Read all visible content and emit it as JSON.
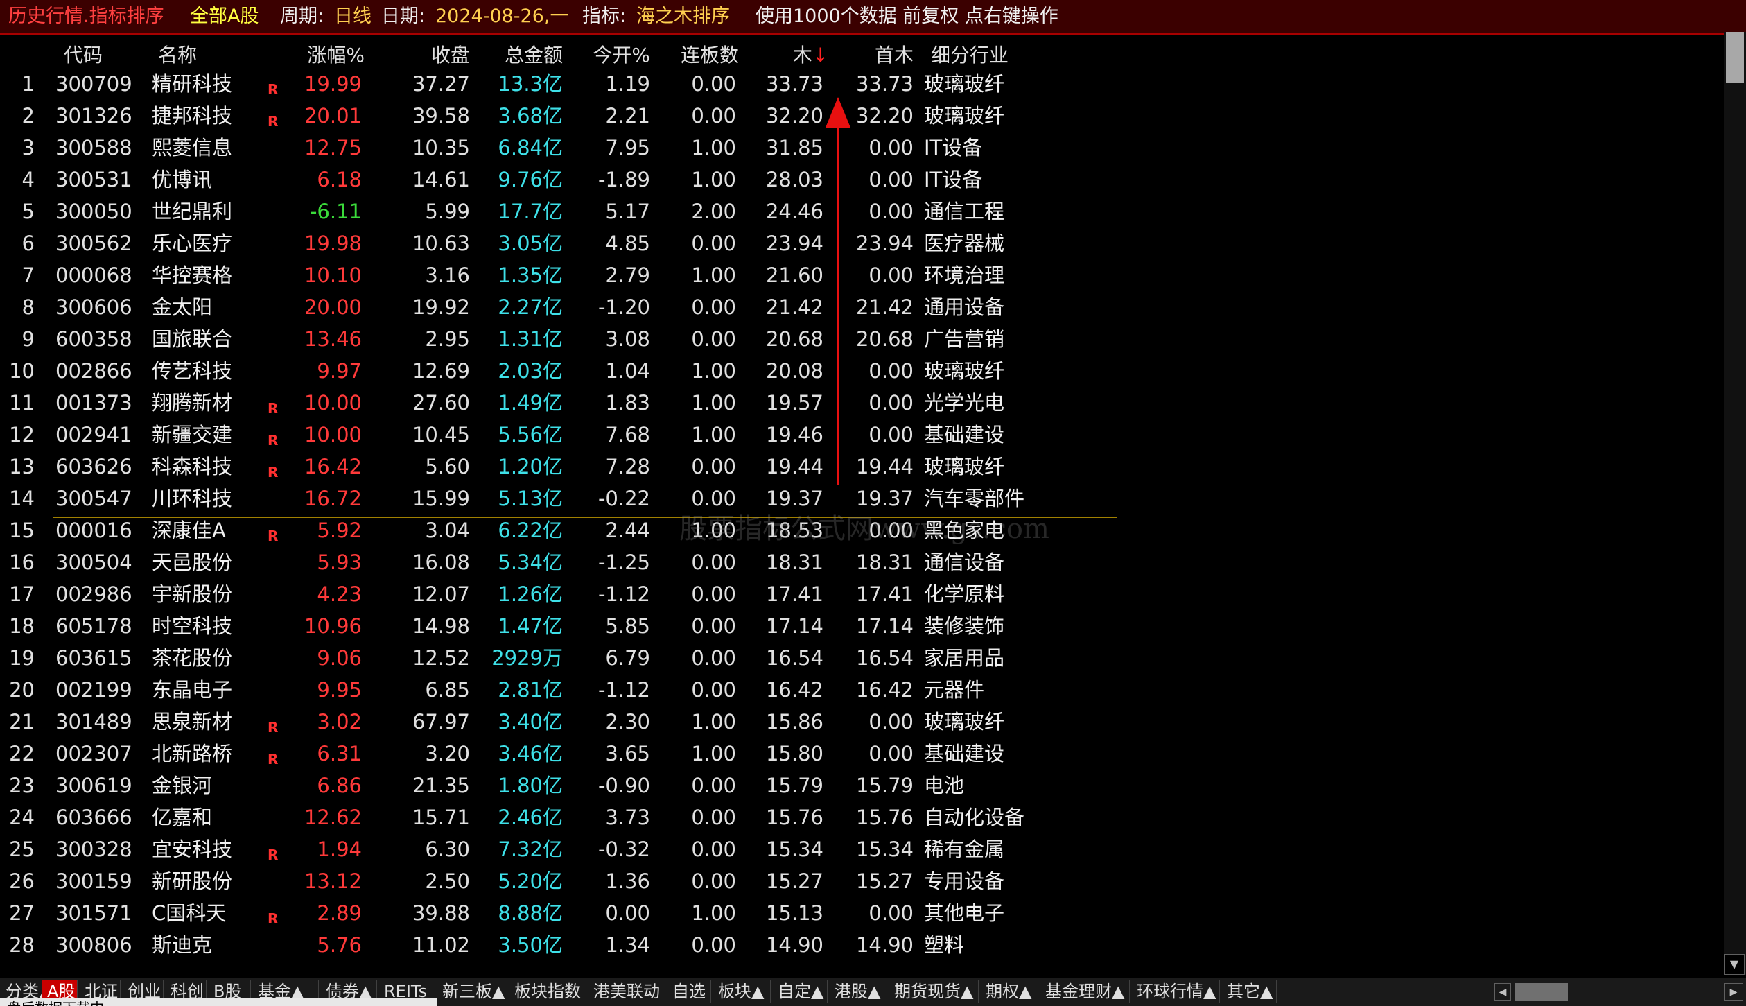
{
  "titlebar": {
    "app_title": "历史行情.指标排序",
    "market": "全部A股",
    "period_label": "周期:",
    "period_value": "日线",
    "date_label": "日期:",
    "date_value": "2024-08-26,一",
    "indicator_label": "指标:",
    "indicator_value": "海之木排序",
    "info": "使用1000个数据 前复权 点右键操作"
  },
  "columns": {
    "code": "代码",
    "name": "名称",
    "change": "涨幅%",
    "close": "收盘",
    "amount": "总金额",
    "open_pct": "今开%",
    "consecutive": "连板数",
    "mu": "木",
    "mu_sort": "↓",
    "first_mu": "首木",
    "industry": "细分行业"
  },
  "rows": [
    {
      "idx": "1",
      "code": "300709",
      "name": "精研科技",
      "r": "R",
      "change": "19.99",
      "dir": "up",
      "close": "37.27",
      "amount": "13.3亿",
      "open": "1.19",
      "cons": "0.00",
      "mu": "33.73",
      "first_mu": "33.73",
      "industry": "玻璃玻纤"
    },
    {
      "idx": "2",
      "code": "301326",
      "name": "捷邦科技",
      "r": "R",
      "change": "20.01",
      "dir": "up",
      "close": "39.58",
      "amount": "3.68亿",
      "open": "2.21",
      "cons": "0.00",
      "mu": "32.20",
      "first_mu": "32.20",
      "industry": "玻璃玻纤"
    },
    {
      "idx": "3",
      "code": "300588",
      "name": "熙菱信息",
      "r": "",
      "change": "12.75",
      "dir": "up",
      "close": "10.35",
      "amount": "6.84亿",
      "open": "7.95",
      "cons": "1.00",
      "mu": "31.85",
      "first_mu": "0.00",
      "industry": "IT设备"
    },
    {
      "idx": "4",
      "code": "300531",
      "name": "优博讯",
      "r": "",
      "change": "6.18",
      "dir": "up",
      "close": "14.61",
      "amount": "9.76亿",
      "open": "-1.89",
      "cons": "1.00",
      "mu": "28.03",
      "first_mu": "0.00",
      "industry": "IT设备"
    },
    {
      "idx": "5",
      "code": "300050",
      "name": "世纪鼎利",
      "r": "",
      "change": "-6.11",
      "dir": "down",
      "close": "5.99",
      "amount": "17.7亿",
      "open": "5.17",
      "cons": "2.00",
      "mu": "24.46",
      "first_mu": "0.00",
      "industry": "通信工程"
    },
    {
      "idx": "6",
      "code": "300562",
      "name": "乐心医疗",
      "r": "",
      "change": "19.98",
      "dir": "up",
      "close": "10.63",
      "amount": "3.05亿",
      "open": "4.85",
      "cons": "0.00",
      "mu": "23.94",
      "first_mu": "23.94",
      "industry": "医疗器械"
    },
    {
      "idx": "7",
      "code": "000068",
      "name": "华控赛格",
      "r": "",
      "change": "10.10",
      "dir": "up",
      "close": "3.16",
      "amount": "1.35亿",
      "open": "2.79",
      "cons": "1.00",
      "mu": "21.60",
      "first_mu": "0.00",
      "industry": "环境治理"
    },
    {
      "idx": "8",
      "code": "300606",
      "name": "金太阳",
      "r": "",
      "change": "20.00",
      "dir": "up",
      "close": "19.92",
      "amount": "2.27亿",
      "open": "-1.20",
      "cons": "0.00",
      "mu": "21.42",
      "first_mu": "21.42",
      "industry": "通用设备"
    },
    {
      "idx": "9",
      "code": "600358",
      "name": "国旅联合",
      "r": "",
      "change": "13.46",
      "dir": "up",
      "close": "2.95",
      "amount": "1.31亿",
      "open": "3.08",
      "cons": "0.00",
      "mu": "20.68",
      "first_mu": "20.68",
      "industry": "广告营销"
    },
    {
      "idx": "10",
      "code": "002866",
      "name": "传艺科技",
      "r": "",
      "change": "9.97",
      "dir": "up",
      "close": "12.69",
      "amount": "2.03亿",
      "open": "1.04",
      "cons": "1.00",
      "mu": "20.08",
      "first_mu": "0.00",
      "industry": "玻璃玻纤"
    },
    {
      "idx": "11",
      "code": "001373",
      "name": "翔腾新材",
      "r": "R",
      "change": "10.00",
      "dir": "up",
      "close": "27.60",
      "amount": "1.49亿",
      "open": "1.83",
      "cons": "1.00",
      "mu": "19.57",
      "first_mu": "0.00",
      "industry": "光学光电"
    },
    {
      "idx": "12",
      "code": "002941",
      "name": "新疆交建",
      "r": "R",
      "change": "10.00",
      "dir": "up",
      "close": "10.45",
      "amount": "5.56亿",
      "open": "7.68",
      "cons": "1.00",
      "mu": "19.46",
      "first_mu": "0.00",
      "industry": "基础建设"
    },
    {
      "idx": "13",
      "code": "603626",
      "name": "科森科技",
      "r": "R",
      "change": "16.42",
      "dir": "up",
      "close": "5.60",
      "amount": "1.20亿",
      "open": "7.28",
      "cons": "0.00",
      "mu": "19.44",
      "first_mu": "19.44",
      "industry": "玻璃玻纤"
    },
    {
      "idx": "14",
      "code": "300547",
      "name": "川环科技",
      "r": "",
      "change": "16.72",
      "dir": "up",
      "close": "15.99",
      "amount": "5.13亿",
      "open": "-0.22",
      "cons": "0.00",
      "mu": "19.37",
      "first_mu": "19.37",
      "industry": "汽车零部件"
    },
    {
      "idx": "15",
      "code": "000016",
      "name": "深康佳A",
      "r": "R",
      "change": "5.92",
      "dir": "up",
      "close": "3.04",
      "amount": "6.22亿",
      "open": "2.44",
      "cons": "1.00",
      "mu": "18.53",
      "first_mu": "0.00",
      "industry": "黑色家电"
    },
    {
      "idx": "16",
      "code": "300504",
      "name": "天邑股份",
      "r": "",
      "change": "5.93",
      "dir": "up",
      "close": "16.08",
      "amount": "5.34亿",
      "open": "-1.25",
      "cons": "0.00",
      "mu": "18.31",
      "first_mu": "18.31",
      "industry": "通信设备"
    },
    {
      "idx": "17",
      "code": "002986",
      "name": "宇新股份",
      "r": "",
      "change": "4.23",
      "dir": "up",
      "close": "12.07",
      "amount": "1.26亿",
      "open": "-1.12",
      "cons": "0.00",
      "mu": "17.41",
      "first_mu": "17.41",
      "industry": "化学原料"
    },
    {
      "idx": "18",
      "code": "605178",
      "name": "时空科技",
      "r": "",
      "change": "10.96",
      "dir": "up",
      "close": "14.98",
      "amount": "1.47亿",
      "open": "5.85",
      "cons": "0.00",
      "mu": "17.14",
      "first_mu": "17.14",
      "industry": "装修装饰"
    },
    {
      "idx": "19",
      "code": "603615",
      "name": "茶花股份",
      "r": "",
      "change": "9.06",
      "dir": "up",
      "close": "12.52",
      "amount": "2929万",
      "open": "6.79",
      "cons": "0.00",
      "mu": "16.54",
      "first_mu": "16.54",
      "industry": "家居用品"
    },
    {
      "idx": "20",
      "code": "002199",
      "name": "东晶电子",
      "r": "",
      "change": "9.95",
      "dir": "up",
      "close": "6.85",
      "amount": "2.81亿",
      "open": "-1.12",
      "cons": "0.00",
      "mu": "16.42",
      "first_mu": "16.42",
      "industry": "元器件"
    },
    {
      "idx": "21",
      "code": "301489",
      "name": "思泉新材",
      "r": "R",
      "change": "3.02",
      "dir": "up",
      "close": "67.97",
      "amount": "3.40亿",
      "open": "2.30",
      "cons": "1.00",
      "mu": "15.86",
      "first_mu": "0.00",
      "industry": "玻璃玻纤"
    },
    {
      "idx": "22",
      "code": "002307",
      "name": "北新路桥",
      "r": "R",
      "change": "6.31",
      "dir": "up",
      "close": "3.20",
      "amount": "3.46亿",
      "open": "3.65",
      "cons": "1.00",
      "mu": "15.80",
      "first_mu": "0.00",
      "industry": "基础建设"
    },
    {
      "idx": "23",
      "code": "300619",
      "name": "金银河",
      "r": "",
      "change": "6.86",
      "dir": "up",
      "close": "21.35",
      "amount": "1.80亿",
      "open": "-0.90",
      "cons": "0.00",
      "mu": "15.79",
      "first_mu": "15.79",
      "industry": "电池"
    },
    {
      "idx": "24",
      "code": "603666",
      "name": "亿嘉和",
      "r": "",
      "change": "12.62",
      "dir": "up",
      "close": "15.71",
      "amount": "2.46亿",
      "open": "3.73",
      "cons": "0.00",
      "mu": "15.76",
      "first_mu": "15.76",
      "industry": "自动化设备"
    },
    {
      "idx": "25",
      "code": "300328",
      "name": "宜安科技",
      "r": "R",
      "change": "1.94",
      "dir": "up",
      "close": "6.30",
      "amount": "7.32亿",
      "open": "-0.32",
      "cons": "0.00",
      "mu": "15.34",
      "first_mu": "15.34",
      "industry": "稀有金属"
    },
    {
      "idx": "26",
      "code": "300159",
      "name": "新研股份",
      "r": "",
      "change": "13.12",
      "dir": "up",
      "close": "2.50",
      "amount": "5.20亿",
      "open": "1.36",
      "cons": "0.00",
      "mu": "15.27",
      "first_mu": "15.27",
      "industry": "专用设备"
    },
    {
      "idx": "27",
      "code": "301571",
      "name": "C国科天",
      "r": "R",
      "change": "2.89",
      "dir": "up",
      "close": "39.88",
      "amount": "8.88亿",
      "open": "0.00",
      "cons": "1.00",
      "mu": "15.13",
      "first_mu": "0.00",
      "industry": "其他电子"
    },
    {
      "idx": "28",
      "code": "300806",
      "name": "斯迪克",
      "r": "",
      "change": "5.76",
      "dir": "up",
      "close": "11.02",
      "amount": "3.50亿",
      "open": "1.34",
      "cons": "0.00",
      "mu": "14.90",
      "first_mu": "14.90",
      "industry": "塑料"
    }
  ],
  "watermark": "股票指标公式网www.gs.com",
  "tabs": [
    {
      "label": "分类▲",
      "active": false
    },
    {
      "label": "A股",
      "active": true
    },
    {
      "label": "北证",
      "active": false
    },
    {
      "label": "创业",
      "active": false
    },
    {
      "label": "科创",
      "active": false
    },
    {
      "label": "B股",
      "active": false
    },
    {
      "label": "基金▲",
      "active": false
    },
    {
      "label": "债券▲",
      "active": false
    },
    {
      "label": "REITs",
      "active": false
    },
    {
      "label": "新三板▲",
      "active": false
    },
    {
      "label": "板块指数",
      "active": false
    },
    {
      "label": "港美联动",
      "active": false
    },
    {
      "label": "自选",
      "active": false
    },
    {
      "label": "板块▲",
      "active": false
    },
    {
      "label": "自定▲",
      "active": false
    },
    {
      "label": "港股▲",
      "active": false
    },
    {
      "label": "期货现货▲",
      "active": false
    },
    {
      "label": "期权▲",
      "active": false
    },
    {
      "label": "基金理财▲",
      "active": false
    },
    {
      "label": "环球行情▲",
      "active": false
    },
    {
      "label": "其它▲",
      "active": false
    }
  ],
  "status": "盘后数据下载中",
  "colors": {
    "up": "#ff3a3a",
    "down": "#3ada3a",
    "amount": "#3ee0e8",
    "title_bg": "#3b0000",
    "active_tab": "#c80000"
  }
}
